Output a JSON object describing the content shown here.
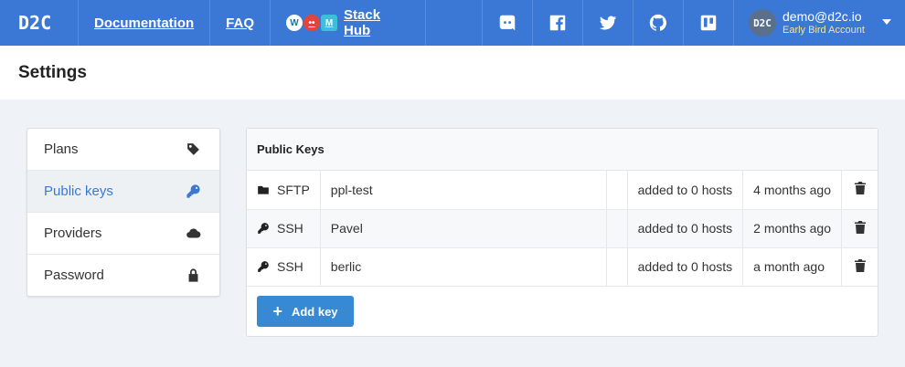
{
  "nav": {
    "brand": "D2C",
    "links": [
      {
        "label": "Documentation"
      },
      {
        "label": "FAQ"
      }
    ],
    "stackhub": {
      "label": "Stack Hub",
      "icons": [
        "wordpress-icon",
        "chat-icon",
        "m-icon"
      ]
    },
    "social": [
      "discord-icon",
      "facebook-icon",
      "twitter-icon",
      "github-icon",
      "trello-icon"
    ],
    "user": {
      "avatar": "D2C",
      "email": "demo@d2c.io",
      "plan": "Early Bird Account"
    }
  },
  "page": {
    "title": "Settings"
  },
  "sidebar": {
    "items": [
      {
        "label": "Plans",
        "icon": "tag-icon"
      },
      {
        "label": "Public keys",
        "icon": "key-icon"
      },
      {
        "label": "Providers",
        "icon": "cloud-icon"
      },
      {
        "label": "Password",
        "icon": "lock-icon"
      }
    ]
  },
  "keys": {
    "title": "Public Keys",
    "rows": [
      {
        "type": "SFTP",
        "icon": "folder-icon",
        "name": "ppl-test",
        "hosts": "added to 0 hosts",
        "time": "4 months ago"
      },
      {
        "type": "SSH",
        "icon": "key-icon",
        "name": "Pavel",
        "hosts": "added to 0 hosts",
        "time": "2 months ago"
      },
      {
        "type": "SSH",
        "icon": "key-icon",
        "name": "berlic",
        "hosts": "added to 0 hosts",
        "time": "a month ago"
      }
    ],
    "add_label": "Add key"
  },
  "colors": {
    "nav": "#3b78d6",
    "accent": "#3b78d6",
    "button": "#3689d2",
    "plan_text": "#f6e39a"
  }
}
